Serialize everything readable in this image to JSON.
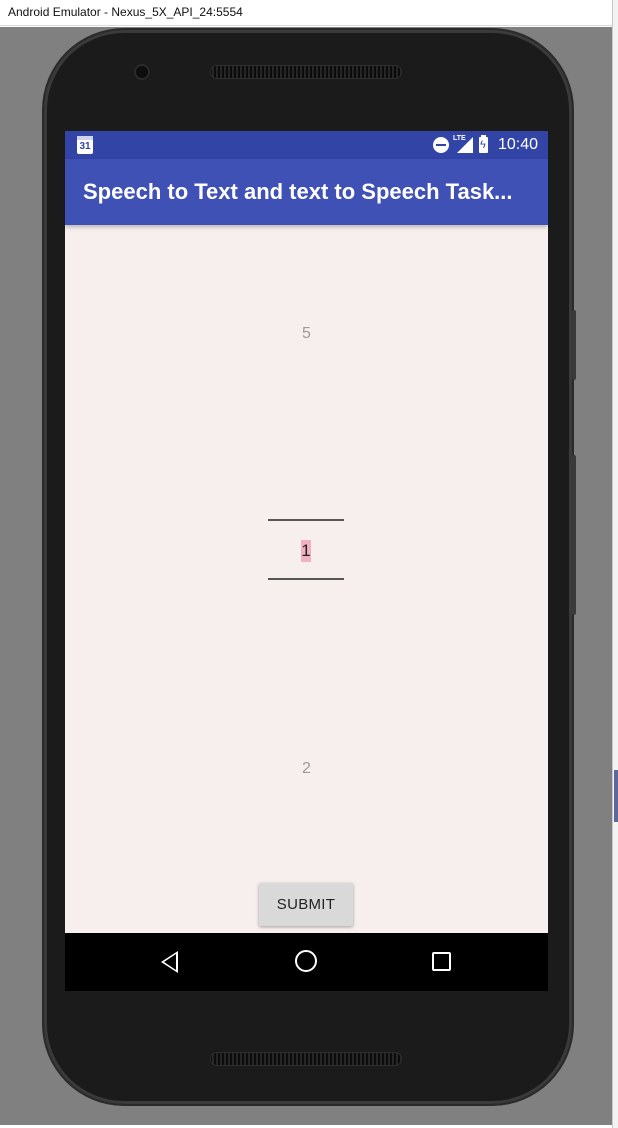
{
  "window": {
    "title": "Android Emulator - Nexus_5X_API_24:5554"
  },
  "status_bar": {
    "calendar_day": "31",
    "network_label": "LTE",
    "time": "10:40"
  },
  "app_bar": {
    "title": "Speech to Text and text to Speech Task..."
  },
  "number_picker": {
    "previous_value": "5",
    "selected_value": "1",
    "next_value": "2"
  },
  "actions": {
    "submit_label": "SUBMIT"
  },
  "colors": {
    "status_bar": "#3344a7",
    "app_bar": "#3f51b5",
    "screen_background": "#f7efed",
    "selection_highlight": "#f2b1c2"
  },
  "icons": {
    "calendar": "calendar-icon",
    "do_not_disturb": "do-not-disturb-icon",
    "signal": "signal-icon",
    "battery": "battery-charging-icon",
    "nav_back": "back-triangle-icon",
    "nav_home": "home-circle-icon",
    "nav_recents": "recents-square-icon"
  }
}
